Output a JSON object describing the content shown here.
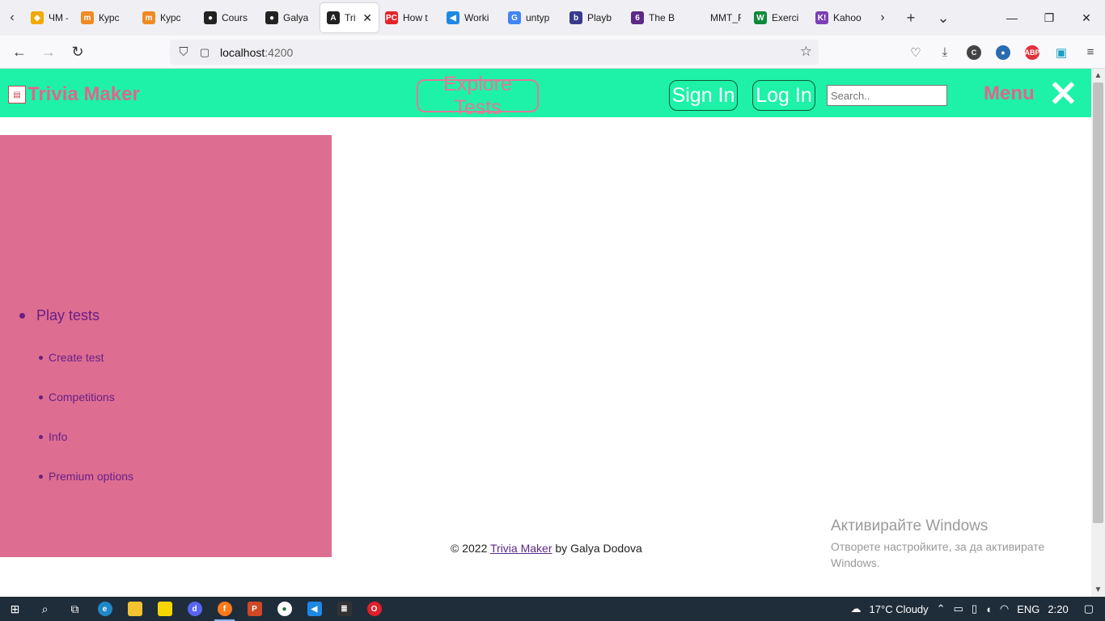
{
  "browser": {
    "tabs": [
      {
        "title": "ЧМ –",
        "color": "#f2a900",
        "glyph": "◆",
        "active": false
      },
      {
        "title": "Курс",
        "color": "#f08a24",
        "glyph": "m",
        "active": false
      },
      {
        "title": "Курс",
        "color": "#f08a24",
        "glyph": "m",
        "active": false
      },
      {
        "title": "Cours",
        "color": "#222222",
        "glyph": "●",
        "active": false
      },
      {
        "title": "Galya",
        "color": "#222222",
        "glyph": "●",
        "active": false
      },
      {
        "title": "Triv",
        "color": "#222222",
        "glyph": "A",
        "active": true
      },
      {
        "title": "How t",
        "color": "#e1242c",
        "glyph": "PC",
        "active": false
      },
      {
        "title": "Worki",
        "color": "#1e88e5",
        "glyph": "◀",
        "active": false
      },
      {
        "title": "untyp",
        "color": "#4285f4",
        "glyph": "G",
        "active": false
      },
      {
        "title": "Playb",
        "color": "#3a3a8c",
        "glyph": "b",
        "active": false
      },
      {
        "title": "The B",
        "color": "#5b2a86",
        "glyph": "6",
        "active": false
      },
      {
        "title": "MMT_FMI",
        "color": "#f0f0f4",
        "glyph": "",
        "active": false
      },
      {
        "title": "Exerci",
        "color": "#0f8a3a",
        "glyph": "W",
        "active": false
      },
      {
        "title": "Kahoo",
        "color": "#7b3fb5",
        "glyph": "K!",
        "active": false
      }
    ],
    "url_host": "localhost",
    "url_port": ":4200"
  },
  "header": {
    "brand": "Trivia Maker",
    "explore": "Explore Tests",
    "sign_in": "Sign In",
    "log_in": "Log In",
    "search_placeholder": "Search..",
    "menu": "Menu",
    "close": "✕"
  },
  "sidebar": {
    "main_item": "Play tests",
    "sub_items": [
      "Create test",
      "Competitions",
      "Info",
      "Premium options"
    ]
  },
  "footer": {
    "prefix": "© 2022 ",
    "link": "Trivia Maker",
    "suffix": " by Galya Dodova"
  },
  "watermark": {
    "title": "Активирайте Windows",
    "subtitle": "Отворете настройките, за да активирате Windows."
  },
  "taskbar": {
    "weather": "17°C  Cloudy",
    "lang": "ENG",
    "time": "2:20"
  },
  "colors": {
    "header_bg": "#1df2a8",
    "sidebar_bg": "#dd6e91",
    "brand": "#e0658c",
    "link": "#6a1e86"
  }
}
